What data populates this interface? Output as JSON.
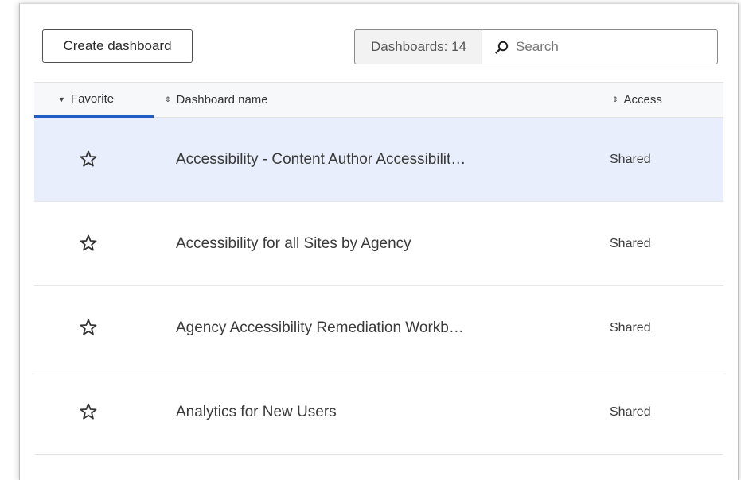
{
  "toolbar": {
    "create_label": "Create dashboard",
    "count_label": "Dashboards: 14",
    "search_placeholder": "Search"
  },
  "columns": {
    "favorite": "Favorite",
    "name": "Dashboard name",
    "access": "Access"
  },
  "rows": [
    {
      "name": "Accessibility - Content Author Accessibilit…",
      "access": "Shared",
      "favorite": false,
      "selected": true
    },
    {
      "name": "Accessibility for all Sites by Agency",
      "access": "Shared",
      "favorite": false,
      "selected": false
    },
    {
      "name": "Agency Accessibility Remediation Workb…",
      "access": "Shared",
      "favorite": false,
      "selected": false
    },
    {
      "name": "Analytics for New Users",
      "access": "Shared",
      "favorite": false,
      "selected": false
    }
  ],
  "icons": {
    "star": "star-outline-icon",
    "search": "search-icon",
    "sort": "sort-icon"
  },
  "colors": {
    "accent": "#1f5fc2",
    "selected_row": "#e8eefb",
    "header_bg": "#f7f8fa"
  }
}
